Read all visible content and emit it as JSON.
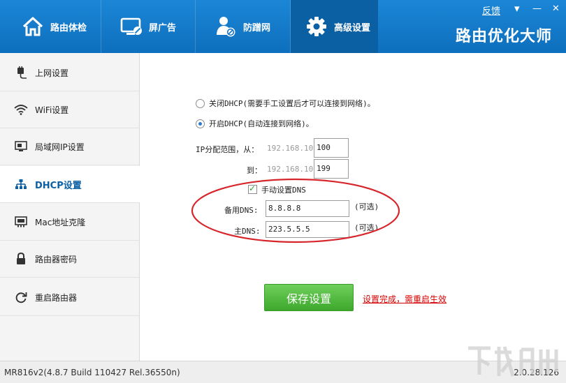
{
  "window": {
    "feedback_label": "反馈",
    "minimize_glyph": "▾",
    "menu_glyph": "—",
    "close_glyph": "✕"
  },
  "tabs": [
    {
      "label": "路由体检",
      "icon": "home-icon"
    },
    {
      "label": "屏广告",
      "icon": "screen-icon"
    },
    {
      "label": "防蹭网",
      "icon": "user-block-icon"
    },
    {
      "label": "高级设置",
      "icon": "gear-icon",
      "active": true
    }
  ],
  "brand": "路由优化大师",
  "sidebar": {
    "items": [
      {
        "label": "上网设置",
        "icon": "plug-icon"
      },
      {
        "label": "WiFi设置",
        "icon": "wifi-icon"
      },
      {
        "label": "局域网IP设置",
        "icon": "lan-icon"
      },
      {
        "label": "DHCP设置",
        "icon": "network-tree-icon",
        "active": true
      },
      {
        "label": "Mac地址克隆",
        "icon": "mac-card-icon"
      },
      {
        "label": "路由器密码",
        "icon": "lock-icon"
      },
      {
        "label": "重启路由器",
        "icon": "refresh-icon"
      }
    ]
  },
  "dhcp": {
    "option_off": "关闭DHCP(需要手工设置后才可以连接到网络)。",
    "option_on": "开启DHCP(自动连接到网络)。",
    "selected": "on",
    "range_label": "IP分配范围，从：",
    "range_to_label": "到：",
    "ip_prefix": "192.168.10.",
    "range_start": "100",
    "range_end": "199",
    "manual_dns_label": "手动设置DNS",
    "manual_dns_checked": true,
    "backup_dns_label": "备用DNS:",
    "backup_dns_value": "8.8.8.8",
    "primary_dns_label": "主DNS:",
    "primary_dns_value": "223.5.5.5",
    "optional_label": "(可选)",
    "save_button": "保存设置",
    "notice": "设置完成，需重启生效"
  },
  "status": {
    "device": "MR816v2(4.8.7 Build 110427 Rel.36550n)",
    "version": "2.0.28.126"
  },
  "colors": {
    "header_blue": "#1c86d6",
    "active_tab": "#0b5fa3",
    "save_green": "#4fbb3c",
    "notice_red": "#d40000",
    "annotation_red": "#d7262b"
  }
}
